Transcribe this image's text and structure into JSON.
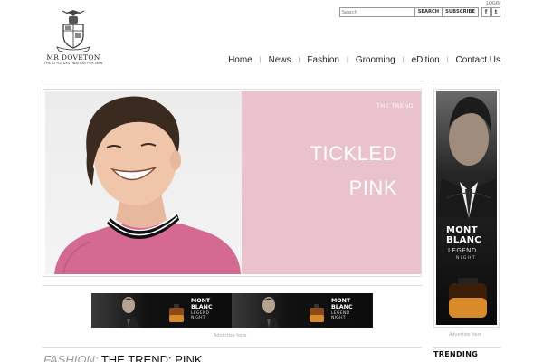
{
  "brand": {
    "name": "MR DOVETON",
    "tagline": "THE STYLE DESTINATION FOR MEN"
  },
  "header": {
    "login": "LOGIN",
    "search_placeholder": "Search",
    "search_label": "SEARCH",
    "subscribe_label": "SUBSCRIBE",
    "social": [
      {
        "icon": "facebook-icon",
        "glyph": "f"
      },
      {
        "icon": "twitter-icon",
        "glyph": "t"
      }
    ]
  },
  "nav": {
    "items": [
      "Home",
      "News",
      "Fashion",
      "Grooming",
      "eDition",
      "Contact Us"
    ],
    "separator": "|"
  },
  "hero": {
    "kicker": "THE TREND",
    "headline_line1": "TICKLED",
    "headline_line2": "PINK",
    "colors": {
      "panel": "#e9c2cb",
      "sweater": "#d46a91"
    }
  },
  "banner_ad": {
    "brand_line1": "MONT",
    "brand_line2": "BLANC",
    "product_line1": "LEGEND",
    "product_line2": "NIGHT",
    "caption": "Advertise here"
  },
  "side_ad": {
    "brand_line1": "MONT",
    "brand_line2": "BLANC",
    "product_line1": "LEGEND",
    "product_line2": "NIGHT",
    "caption": "Advertise here"
  },
  "article": {
    "category": "FASHION:",
    "title": "THE TREND: PINK"
  },
  "sidebar": {
    "trending_label": "TRENDING"
  }
}
